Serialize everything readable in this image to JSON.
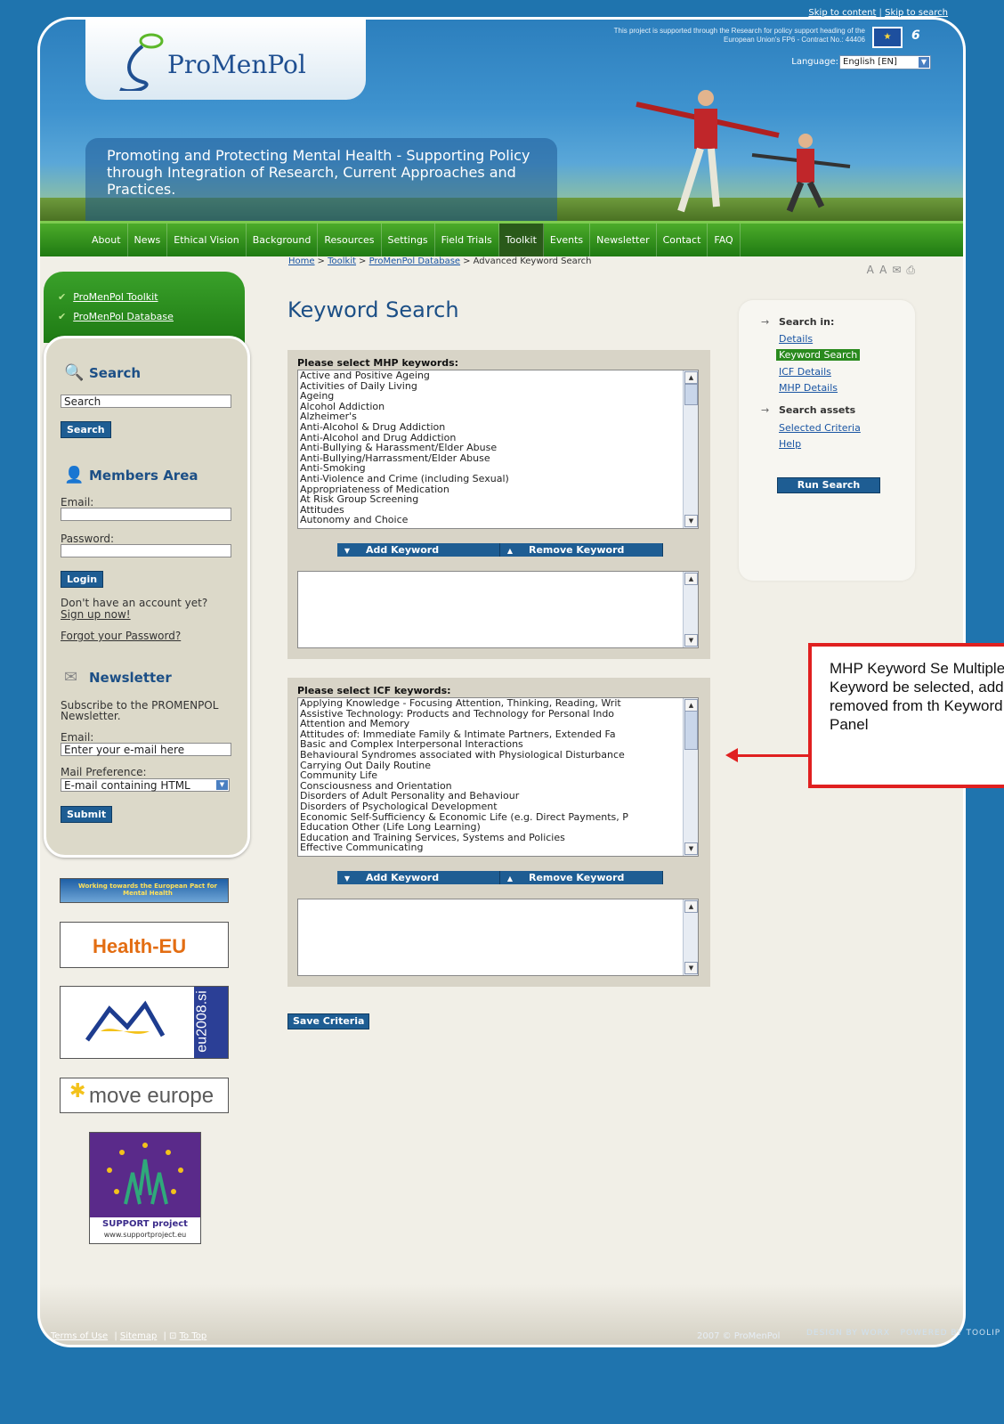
{
  "skip_links": [
    "Skip to content",
    "Skip to search"
  ],
  "header": {
    "logo_text": "ProMenPol",
    "eu_note": "This project is supported through the Research for policy support heading of the European Union's FP6 - Contract No.: 44406",
    "language_label": "Language:",
    "language_value": "English [EN]",
    "tagline": "Promoting and Protecting Mental Health - Supporting Policy through Integration of Research, Current Approaches and Practices."
  },
  "nav": [
    {
      "label": "About"
    },
    {
      "label": "News"
    },
    {
      "label": "Ethical Vision"
    },
    {
      "label": "Background"
    },
    {
      "label": "Resources"
    },
    {
      "label": "Settings"
    },
    {
      "label": "Field Trials"
    },
    {
      "label": "Toolkit"
    },
    {
      "label": "Events"
    },
    {
      "label": "Newsletter"
    },
    {
      "label": "Contact"
    },
    {
      "label": "FAQ"
    }
  ],
  "breadcrumb": {
    "home": "Home",
    "toolkit": "Toolkit",
    "database": "ProMenPol Database",
    "current": "Advanced Keyword Search",
    "sep": ">"
  },
  "left": {
    "top_links": [
      "ProMenPol Toolkit",
      "ProMenPol Database"
    ],
    "search_heading": "Search",
    "search_value": "Search",
    "search_button": "Search",
    "members_heading": "Members Area",
    "email_label": "Email:",
    "password_label": "Password:",
    "login_button": "Login",
    "no_account": "Don't have an account yet?",
    "signup": "Sign up now!",
    "forgot": "Forgot your Password?",
    "newsletter_heading": "Newsletter",
    "newsletter_text": "Subscribe to the PROMENPOL Newsletter.",
    "nl_email_label": "Email:",
    "nl_email_placeholder": "Enter your e-mail here",
    "mail_pref_label": "Mail Preference:",
    "mail_pref_value": "E-mail containing HTML",
    "submit_button": "Submit"
  },
  "banners": {
    "pact": "Working towards the European Pact for Mental Health",
    "health_eu": "Health-EU",
    "eu2008": "eu2008.si",
    "move_europe": "move europe",
    "support_title": "SUPPORT project",
    "support_url": "www.supportproject.eu"
  },
  "main": {
    "title": "Keyword Search",
    "mhp_label": "Please select MHP keywords:",
    "mhp_keywords": [
      "Active and Positive Ageing",
      "Activities of Daily Living",
      "Ageing",
      "Alcohol Addiction",
      "Alzheimer's",
      "Anti-Alcohol & Drug Addiction",
      "Anti-Alcohol and Drug Addiction",
      "Anti-Bullying & Harassment/Elder Abuse",
      "Anti-Bullying/Harrassment/Elder Abuse",
      "Anti-Smoking",
      "Anti-Violence and Crime (including Sexual)",
      "Appropriateness of Medication",
      "At Risk Group Screening",
      "Attitudes",
      "Autonomy and Choice"
    ],
    "icf_label": "Please select ICF keywords:",
    "icf_keywords": [
      "Applying Knowledge - Focusing Attention, Thinking, Reading, Writ",
      "Assistive Technology: Products and Technology for Personal Indo",
      "Attention and Memory",
      "Attitudes of: Immediate Family & Intimate Partners, Extended Fa",
      "Basic and Complex Interpersonal Interactions",
      "Behavioural Syndromes associated with Physiological Disturbance",
      "Carrying Out Daily Routine",
      "Community Life",
      "Consciousness and Orientation",
      "Disorders of Adult Personality and Behaviour",
      "Disorders of Psychological Development",
      "Economic Self-Sufficiency & Economic Life (e.g. Direct Payments, P",
      "Education Other (Life Long Learning)",
      "Education and Training Services, Systems and Policies",
      "Effective Communicating"
    ],
    "add_keyword": "Add Keyword",
    "remove_keyword": "Remove Keyword",
    "save_criteria": "Save Criteria"
  },
  "right": {
    "search_in": "Search in:",
    "links": [
      "Details",
      "Keyword Search",
      "ICF Details",
      "MHP Details"
    ],
    "search_assets": "Search assets",
    "asset_links": [
      "Selected Criteria",
      "Help"
    ],
    "run_search": "Run Search"
  },
  "callout": "MHP Keyword Se Multiple Keyword be selected, adde removed from th Keyword Panel",
  "footer": {
    "terms": "Terms of Use",
    "sitemap": "Sitemap",
    "top": "To Top",
    "copyright": "2007 © ProMenPol",
    "designed_by": "DESIGN BY WORX",
    "powered_by": "POWERED BY TOOLIP"
  },
  "colors": {
    "accent_blue": "#1e5d93",
    "nav_green": "#2f8f1c",
    "page_bg": "#1f74ae",
    "callout_red": "#e02020"
  }
}
